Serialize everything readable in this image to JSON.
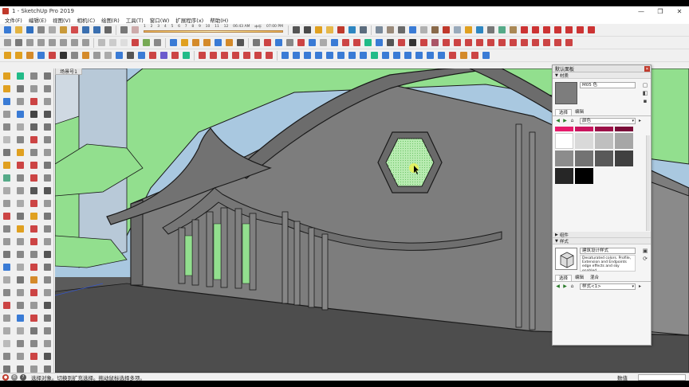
{
  "window": {
    "title": "1 - SketchUp Pro 2019",
    "minimize_glyph": "—",
    "maximize_glyph": "❐",
    "close_glyph": "✕"
  },
  "menu": [
    "文件(F)",
    "编辑(E)",
    "视图(V)",
    "相机(C)",
    "绘图(R)",
    "工具(T)",
    "窗口(W)",
    "扩展程序(x)",
    "帮助(H)"
  ],
  "shadow": {
    "months": [
      "1",
      "2",
      "3",
      "4",
      "5",
      "6",
      "7",
      "8",
      "9",
      "10",
      "11",
      "12"
    ],
    "time_start": "06:43 AM",
    "time_mid": "中午",
    "time_end": "07:00 PM"
  },
  "scene": {
    "tab_label": "场景号1"
  },
  "colors": {
    "sky": "#a9c8e0",
    "wall": "#7a7a7a",
    "wall_light": "#8b8b8b",
    "ground": "#5a5a5a",
    "grass": "#92df8e",
    "edge": "#1a1a1a",
    "roof": "#6f6f6f"
  },
  "tray": {
    "title": "默认面板",
    "materials": {
      "header": "材质",
      "name": "M05 色",
      "tabs": [
        "选择",
        "编辑"
      ],
      "collection": "颜色",
      "swatches": [
        "#e61b6b",
        "#c9155e",
        "#9c1148",
        "#7a0e39",
        "#ffffff",
        "#d9d9d9",
        "#bfbfbf",
        "#a6a6a6",
        "#8c8c8c",
        "#737373",
        "#595959",
        "#404040",
        "#262626",
        "#000000"
      ]
    },
    "components_header": "组件",
    "styles": {
      "header": "样式",
      "name": "建筑设计样式",
      "description": "Desaturated colors. Profile, Extension and Endpoints edge effects and sky enabled.",
      "tabs": [
        "选择",
        "编辑",
        "混合"
      ],
      "collection": "样式<1>"
    }
  },
  "status": {
    "message": "选择对象。切换到扩充选择。拖动鼠标选择多项。",
    "vcb_label": "数值"
  }
}
